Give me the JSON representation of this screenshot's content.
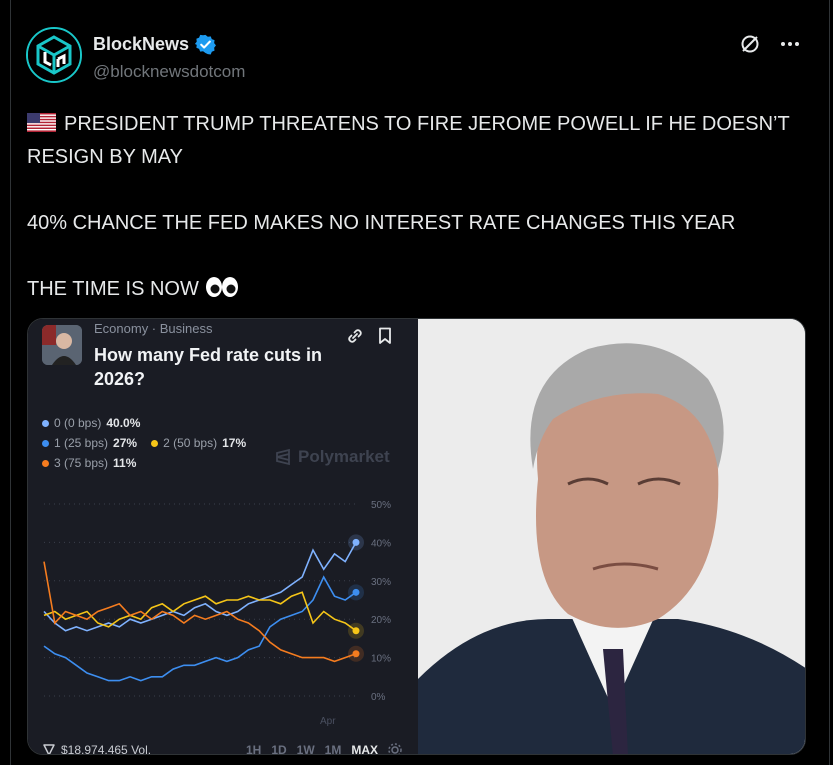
{
  "account": {
    "name": "BlockNews",
    "handle": "@blocknewsdotcom",
    "verified": true,
    "avatar_icon": "blocknews-logo-icon"
  },
  "tweet": {
    "line1": "PRESIDENT TRUMP THREATENS TO FIRE JEROME POWELL IF HE DOESN’T RESIGN BY MAY",
    "line2": "40% CHANCE THE FED MAKES NO INTEREST RATE CHANGES THIS YEAR",
    "line3": "THE TIME IS NOW",
    "flag_emoji": "us-flag-icon",
    "eyes_emoji": "eyes-icon"
  },
  "market_card": {
    "breadcrumb": "Economy · Business",
    "question": "How many Fed rate cuts in 2026?",
    "watermark": "Polymarket",
    "volume": "$18,974,465 Vol.",
    "ranges": [
      "1H",
      "1D",
      "1W",
      "1M",
      "MAX"
    ],
    "active_range": "MAX",
    "legend": [
      {
        "label": "0 (0 bps)",
        "value": "40.0%",
        "color": "#7fb2ff"
      },
      {
        "label": "1 (25 bps)",
        "value": "27%",
        "color": "#3d8ef0"
      },
      {
        "label": "2 (50 bps)",
        "value": "17%",
        "color": "#f5c518"
      },
      {
        "label": "3 (75 bps)",
        "value": "11%",
        "color": "#f57c1f"
      }
    ]
  },
  "chart_data": {
    "type": "line",
    "x_tick_labels": [
      "Apr"
    ],
    "y_ticks": [
      "50%",
      "40%",
      "30%",
      "20%",
      "10%",
      "0%"
    ],
    "ylim": [
      0,
      50
    ],
    "grid": true,
    "series": [
      {
        "name": "0 (0 bps)",
        "color": "#7fb2ff",
        "values": [
          22,
          19,
          17,
          18,
          17,
          18,
          19,
          18,
          20,
          19,
          20,
          21,
          22,
          21,
          23,
          24,
          22,
          21,
          22,
          24,
          25,
          26,
          27,
          29,
          31,
          38,
          33,
          37,
          35,
          40
        ]
      },
      {
        "name": "1 (25 bps)",
        "color": "#3d8ef0",
        "values": [
          13,
          11,
          10,
          8,
          6,
          5,
          4,
          4,
          5,
          4,
          5,
          5,
          7,
          8,
          8,
          9,
          10,
          9,
          10,
          12,
          13,
          18,
          20,
          21,
          22,
          25,
          31,
          26,
          25,
          27
        ]
      },
      {
        "name": "2 (50 bps)",
        "color": "#f5c518",
        "values": [
          21,
          22,
          20,
          21,
          22,
          19,
          18,
          20,
          21,
          20,
          23,
          24,
          22,
          24,
          25,
          26,
          24,
          25,
          25,
          26,
          25,
          25,
          24,
          26,
          27,
          19,
          22,
          20,
          19,
          17
        ]
      },
      {
        "name": "3 (75 bps)",
        "color": "#f57c1f",
        "values": [
          35,
          19,
          22,
          21,
          20,
          22,
          23,
          24,
          21,
          22,
          20,
          22,
          21,
          19,
          21,
          20,
          21,
          22,
          20,
          19,
          17,
          14,
          12,
          11,
          10,
          10,
          10,
          9,
          10,
          11
        ]
      }
    ]
  },
  "photo": {
    "subject_icon": "portrait-photo"
  }
}
